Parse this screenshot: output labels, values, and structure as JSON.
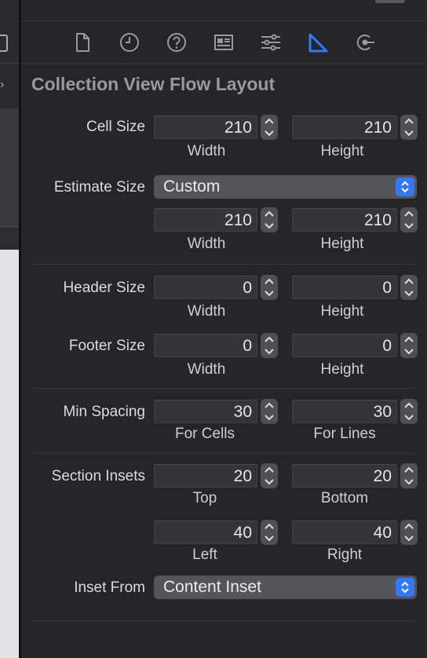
{
  "panel_title": "Collection View Flow Layout",
  "inspector_tabs": [
    {
      "name": "file-inspector",
      "icon": "document-icon",
      "active": false
    },
    {
      "name": "history-inspector",
      "icon": "clock-icon",
      "active": false
    },
    {
      "name": "help-inspector",
      "icon": "question-icon",
      "active": false
    },
    {
      "name": "identity-inspector",
      "icon": "id-card-icon",
      "active": false
    },
    {
      "name": "attributes-inspector",
      "icon": "sliders-icon",
      "active": false
    },
    {
      "name": "size-inspector",
      "icon": "ruler-triangle-icon",
      "active": true
    },
    {
      "name": "connections-inspector",
      "icon": "connection-arrow-icon",
      "active": false
    }
  ],
  "accent_color": "#3478f6",
  "cell_size": {
    "label": "Cell Size",
    "width": "210",
    "height": "210",
    "width_label": "Width",
    "height_label": "Height"
  },
  "estimate_size": {
    "label": "Estimate Size",
    "mode": "Custom",
    "width": "210",
    "height": "210",
    "width_label": "Width",
    "height_label": "Height"
  },
  "header_size": {
    "label": "Header Size",
    "width": "0",
    "height": "0",
    "width_label": "Width",
    "height_label": "Height"
  },
  "footer_size": {
    "label": "Footer Size",
    "width": "0",
    "height": "0",
    "width_label": "Width",
    "height_label": "Height"
  },
  "min_spacing": {
    "label": "Min Spacing",
    "cells": "30",
    "lines": "30",
    "cells_label": "For Cells",
    "lines_label": "For Lines"
  },
  "section_insets": {
    "label": "Section Insets",
    "top": "20",
    "bottom": "20",
    "left": "40",
    "right": "40",
    "top_label": "Top",
    "bottom_label": "Bottom",
    "left_label": "Left",
    "right_label": "Right"
  },
  "inset_from": {
    "label": "Inset From",
    "value": "Content Inset"
  }
}
